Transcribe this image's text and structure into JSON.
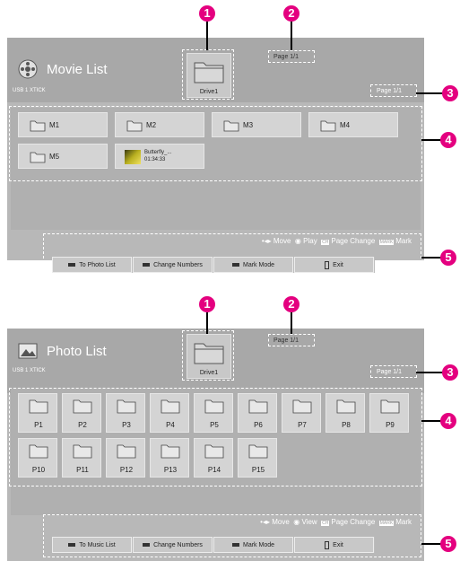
{
  "callouts": [
    "1",
    "2",
    "3",
    "4",
    "5"
  ],
  "colors": {
    "callout": "#e4007f",
    "panel": "#b8b8b8",
    "header": "#a8a8a8"
  },
  "movie": {
    "title": "Movie List",
    "device": "USB 1 XTICK",
    "drive_label": "Drive1",
    "page_top": "Page 1/1",
    "page_right": "Page 1/1",
    "items": [
      {
        "label": "M1",
        "icon": "folder-icon"
      },
      {
        "label": "M2",
        "icon": "folder-icon"
      },
      {
        "label": "M3",
        "icon": "folder-icon"
      },
      {
        "label": "M4",
        "icon": "folder-icon"
      },
      {
        "label": "M5",
        "icon": "folder-icon"
      }
    ],
    "file": {
      "name": "Butterfly_...",
      "time": "01:34:33",
      "icon": "thumbnail"
    },
    "controls": {
      "move": "Move",
      "play": "Play",
      "page_change": "Page Change",
      "mark": "Mark",
      "ch": "CH",
      "mark_key": "MARK"
    },
    "buttons": [
      "To Photo List",
      "Change Numbers",
      "Mark Mode",
      "Exit"
    ]
  },
  "photo": {
    "title": "Photo List",
    "device": "USB 1 XTICK",
    "drive_label": "Drive1",
    "page_top": "Page 1/1",
    "page_right": "Page 1/1",
    "items": [
      "P1",
      "P2",
      "P3",
      "P4",
      "P5",
      "P6",
      "P7",
      "P8",
      "P9",
      "P10",
      "P11",
      "P12",
      "P13",
      "P14",
      "P15"
    ],
    "controls": {
      "move": "Move",
      "view": "View",
      "page_change": "Page Change",
      "mark": "Mark",
      "ch": "CH",
      "mark_key": "MARK"
    },
    "buttons": [
      "To Music List",
      "Change Numbers",
      "Mark Mode",
      "Exit"
    ]
  }
}
